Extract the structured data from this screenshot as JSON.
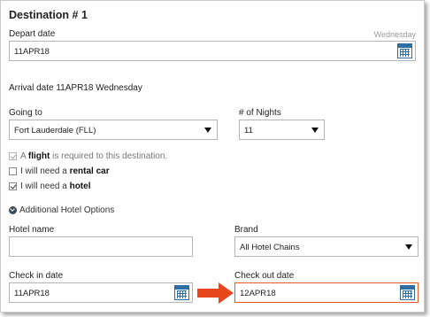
{
  "destination": {
    "title": "Destination # 1",
    "depart_date_label": "Depart date",
    "depart_weekday": "Wednesday",
    "depart_date_value": "11APR18",
    "arrival_text": "Arrival date 11APR18 Wednesday",
    "going_to_label": "Going to",
    "going_to_value": "Fort Lauderdale (FLL)",
    "nights_label": "# of Nights",
    "nights_value": "11"
  },
  "options": {
    "flight": {
      "prefix": "A",
      "bold": "flight",
      "suffix": "is required to this destination.",
      "checked": true,
      "disabled": true
    },
    "rental_car": {
      "prefix": "I will need a",
      "bold": "rental car",
      "checked": false
    },
    "hotel": {
      "prefix": "I will need a",
      "bold": "hotel",
      "checked": true
    },
    "additional_hotel_options": "Additional Hotel Options"
  },
  "hotel": {
    "hotel_name_label": "Hotel name",
    "hotel_name_value": "",
    "brand_label": "Brand",
    "brand_value": "All Hotel Chains",
    "check_in_label": "Check in date",
    "check_in_value": "11APR18",
    "check_out_label": "Check out date",
    "check_out_value": "12APR18"
  },
  "colors": {
    "arrow": "#e8471e",
    "highlight_border": "#e85a2a",
    "calendar_blue": "#2e6da4"
  },
  "icons": [
    "calendar-icon",
    "chevron-down-icon",
    "checkmark-icon",
    "arrow-right-icon"
  ]
}
